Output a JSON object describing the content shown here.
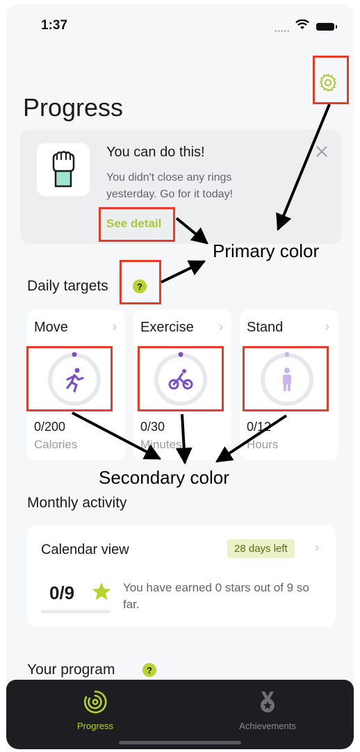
{
  "status": {
    "time": "1:37"
  },
  "page": {
    "title": "Progress"
  },
  "motivation": {
    "title": "You can do this!",
    "text": "You didn't close any rings yesterday. Go for it today!",
    "link": "See detail"
  },
  "daily_targets": {
    "label": "Daily targets",
    "help": "?",
    "items": [
      {
        "title": "Move",
        "value": "0/200",
        "unit": "Calories",
        "icon": "run-icon"
      },
      {
        "title": "Exercise",
        "value": "0/30",
        "unit": "Minutes",
        "icon": "bike-icon"
      },
      {
        "title": "Stand",
        "value": "0/12",
        "unit": "Hours",
        "icon": "stand-icon"
      }
    ]
  },
  "monthly": {
    "label": "Monthly activity",
    "calendar": "Calendar view",
    "days_left": "28 days left",
    "stars": "0/9",
    "stars_text": "You have earned 0 stars out of 9 so far."
  },
  "program": {
    "label": "Your program",
    "help": "?"
  },
  "tabs": [
    {
      "label": "Progress",
      "active": true
    },
    {
      "label": "Achievements",
      "active": false
    }
  ],
  "annotations": {
    "primary": "Primary color",
    "secondary": "Secondary color"
  },
  "colors": {
    "primary": "#a9c93b",
    "secondary": "#7b4fc4",
    "highlight": "#e33c2a"
  }
}
